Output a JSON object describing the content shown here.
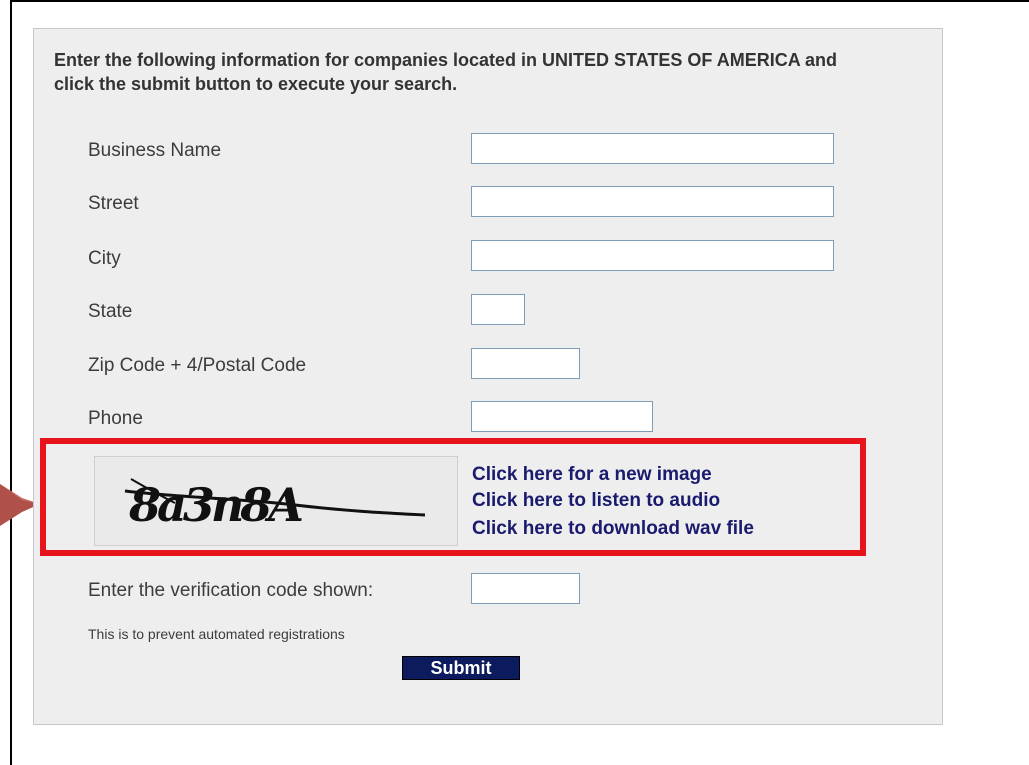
{
  "intro_text": "Enter the following information for companies located in UNITED STATES OF AMERICA and click the submit button to execute your search.",
  "fields": [
    {
      "label": "Business Name",
      "value": ""
    },
    {
      "label": "Street",
      "value": ""
    },
    {
      "label": "City",
      "value": ""
    },
    {
      "label": "State",
      "value": ""
    },
    {
      "label": "Zip Code + 4/Postal Code",
      "value": ""
    },
    {
      "label": "Phone",
      "value": ""
    }
  ],
  "captcha": {
    "image_text": "8a3n8A",
    "new_image_link": "Click here for a new image",
    "audio_link": "Click here to listen to audio",
    "download_link": "Click here to download wav file",
    "highlight_color": "#e8141b"
  },
  "verification": {
    "label": "Enter the verification code shown:",
    "value": "",
    "note": "This is to prevent automated registrations"
  },
  "submit_label": "Submit",
  "colors": {
    "panel_bg": "#eeeeee",
    "link": "#1a1a6e",
    "button_bg": "#0c1a5e"
  }
}
